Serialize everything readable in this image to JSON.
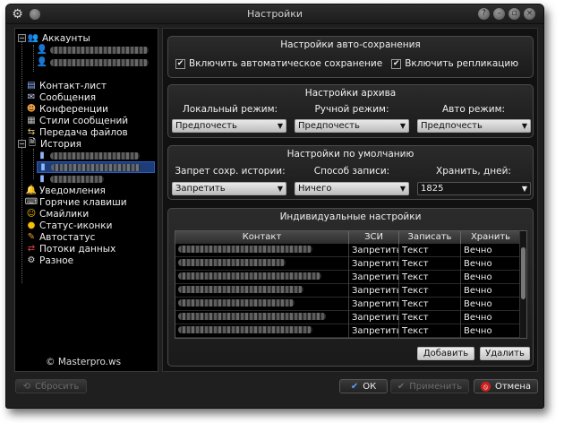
{
  "window": {
    "title": "Настройки"
  },
  "sidebar": {
    "accounts_label": "Аккаунты",
    "items": [
      {
        "label": "Контакт-лист",
        "icon": "contact-list-icon"
      },
      {
        "label": "Сообщения",
        "icon": "envelope-icon"
      },
      {
        "label": "Конференции",
        "icon": "people-icon"
      },
      {
        "label": "Стили сообщений",
        "icon": "styles-icon"
      },
      {
        "label": "Передача файлов",
        "icon": "file-transfer-icon"
      },
      {
        "label": "История",
        "icon": "history-icon"
      },
      {
        "label": "Уведомления",
        "icon": "bell-icon"
      },
      {
        "label": "Горячие клавиши",
        "icon": "keyboard-icon"
      },
      {
        "label": "Смайлики",
        "icon": "smiley-icon"
      },
      {
        "label": "Статус-иконки",
        "icon": "status-icon"
      },
      {
        "label": "Автостатус",
        "icon": "autostatus-icon"
      },
      {
        "label": "Потоки данных",
        "icon": "data-streams-icon"
      },
      {
        "label": "Разное",
        "icon": "gear-icon"
      }
    ],
    "watermark": "© Masterpro.ws"
  },
  "autosave": {
    "title": "Настройки авто-сохранения",
    "enable_autosave": "Включить автоматическое сохранение",
    "enable_replication": "Включить репликацию",
    "autosave_checked": true,
    "replication_checked": true
  },
  "archive": {
    "title": "Настройки архива",
    "local_label": "Локальный режим:",
    "manual_label": "Ручной режим:",
    "auto_label": "Авто режим:",
    "local_value": "Предпочесть",
    "manual_value": "Предпочесть",
    "auto_value": "Предпочесть"
  },
  "defaults": {
    "title": "Настройки по умолчанию",
    "deny_label": "Запрет сохр. истории:",
    "method_label": "Способ записи:",
    "keep_label": "Хранить, дней:",
    "deny_value": "Запретить",
    "method_value": "Ничего",
    "keep_value": "1825"
  },
  "individual": {
    "title": "Индивидуальные настройки",
    "columns": [
      "Контакт",
      "ЗСИ",
      "Записать",
      "Хранить"
    ],
    "rows": [
      {
        "zsi": "Запретить",
        "write": "Текст",
        "keep": "Вечно"
      },
      {
        "zsi": "Запретить",
        "write": "Текст",
        "keep": "Вечно"
      },
      {
        "zsi": "Запретить",
        "write": "Текст",
        "keep": "Вечно"
      },
      {
        "zsi": "Запретить",
        "write": "Текст",
        "keep": "Вечно"
      },
      {
        "zsi": "Запретить",
        "write": "Текст",
        "keep": "Вечно"
      },
      {
        "zsi": "Запретить",
        "write": "Текст",
        "keep": "Вечно"
      },
      {
        "zsi": "Запретить",
        "write": "Текст",
        "keep": "Вечно"
      }
    ],
    "add_label": "Добавить",
    "delete_label": "Удалить"
  },
  "footer": {
    "reset_label": "Сбросить",
    "ok_label": "ОК",
    "apply_label": "Применить",
    "cancel_label": "Отмена"
  },
  "colors": {
    "selection": "#1c3d7a",
    "window_bg": "#1f1f1f",
    "cancel_icon": "#d01f1f",
    "ok_check": "#5aa0ff"
  }
}
